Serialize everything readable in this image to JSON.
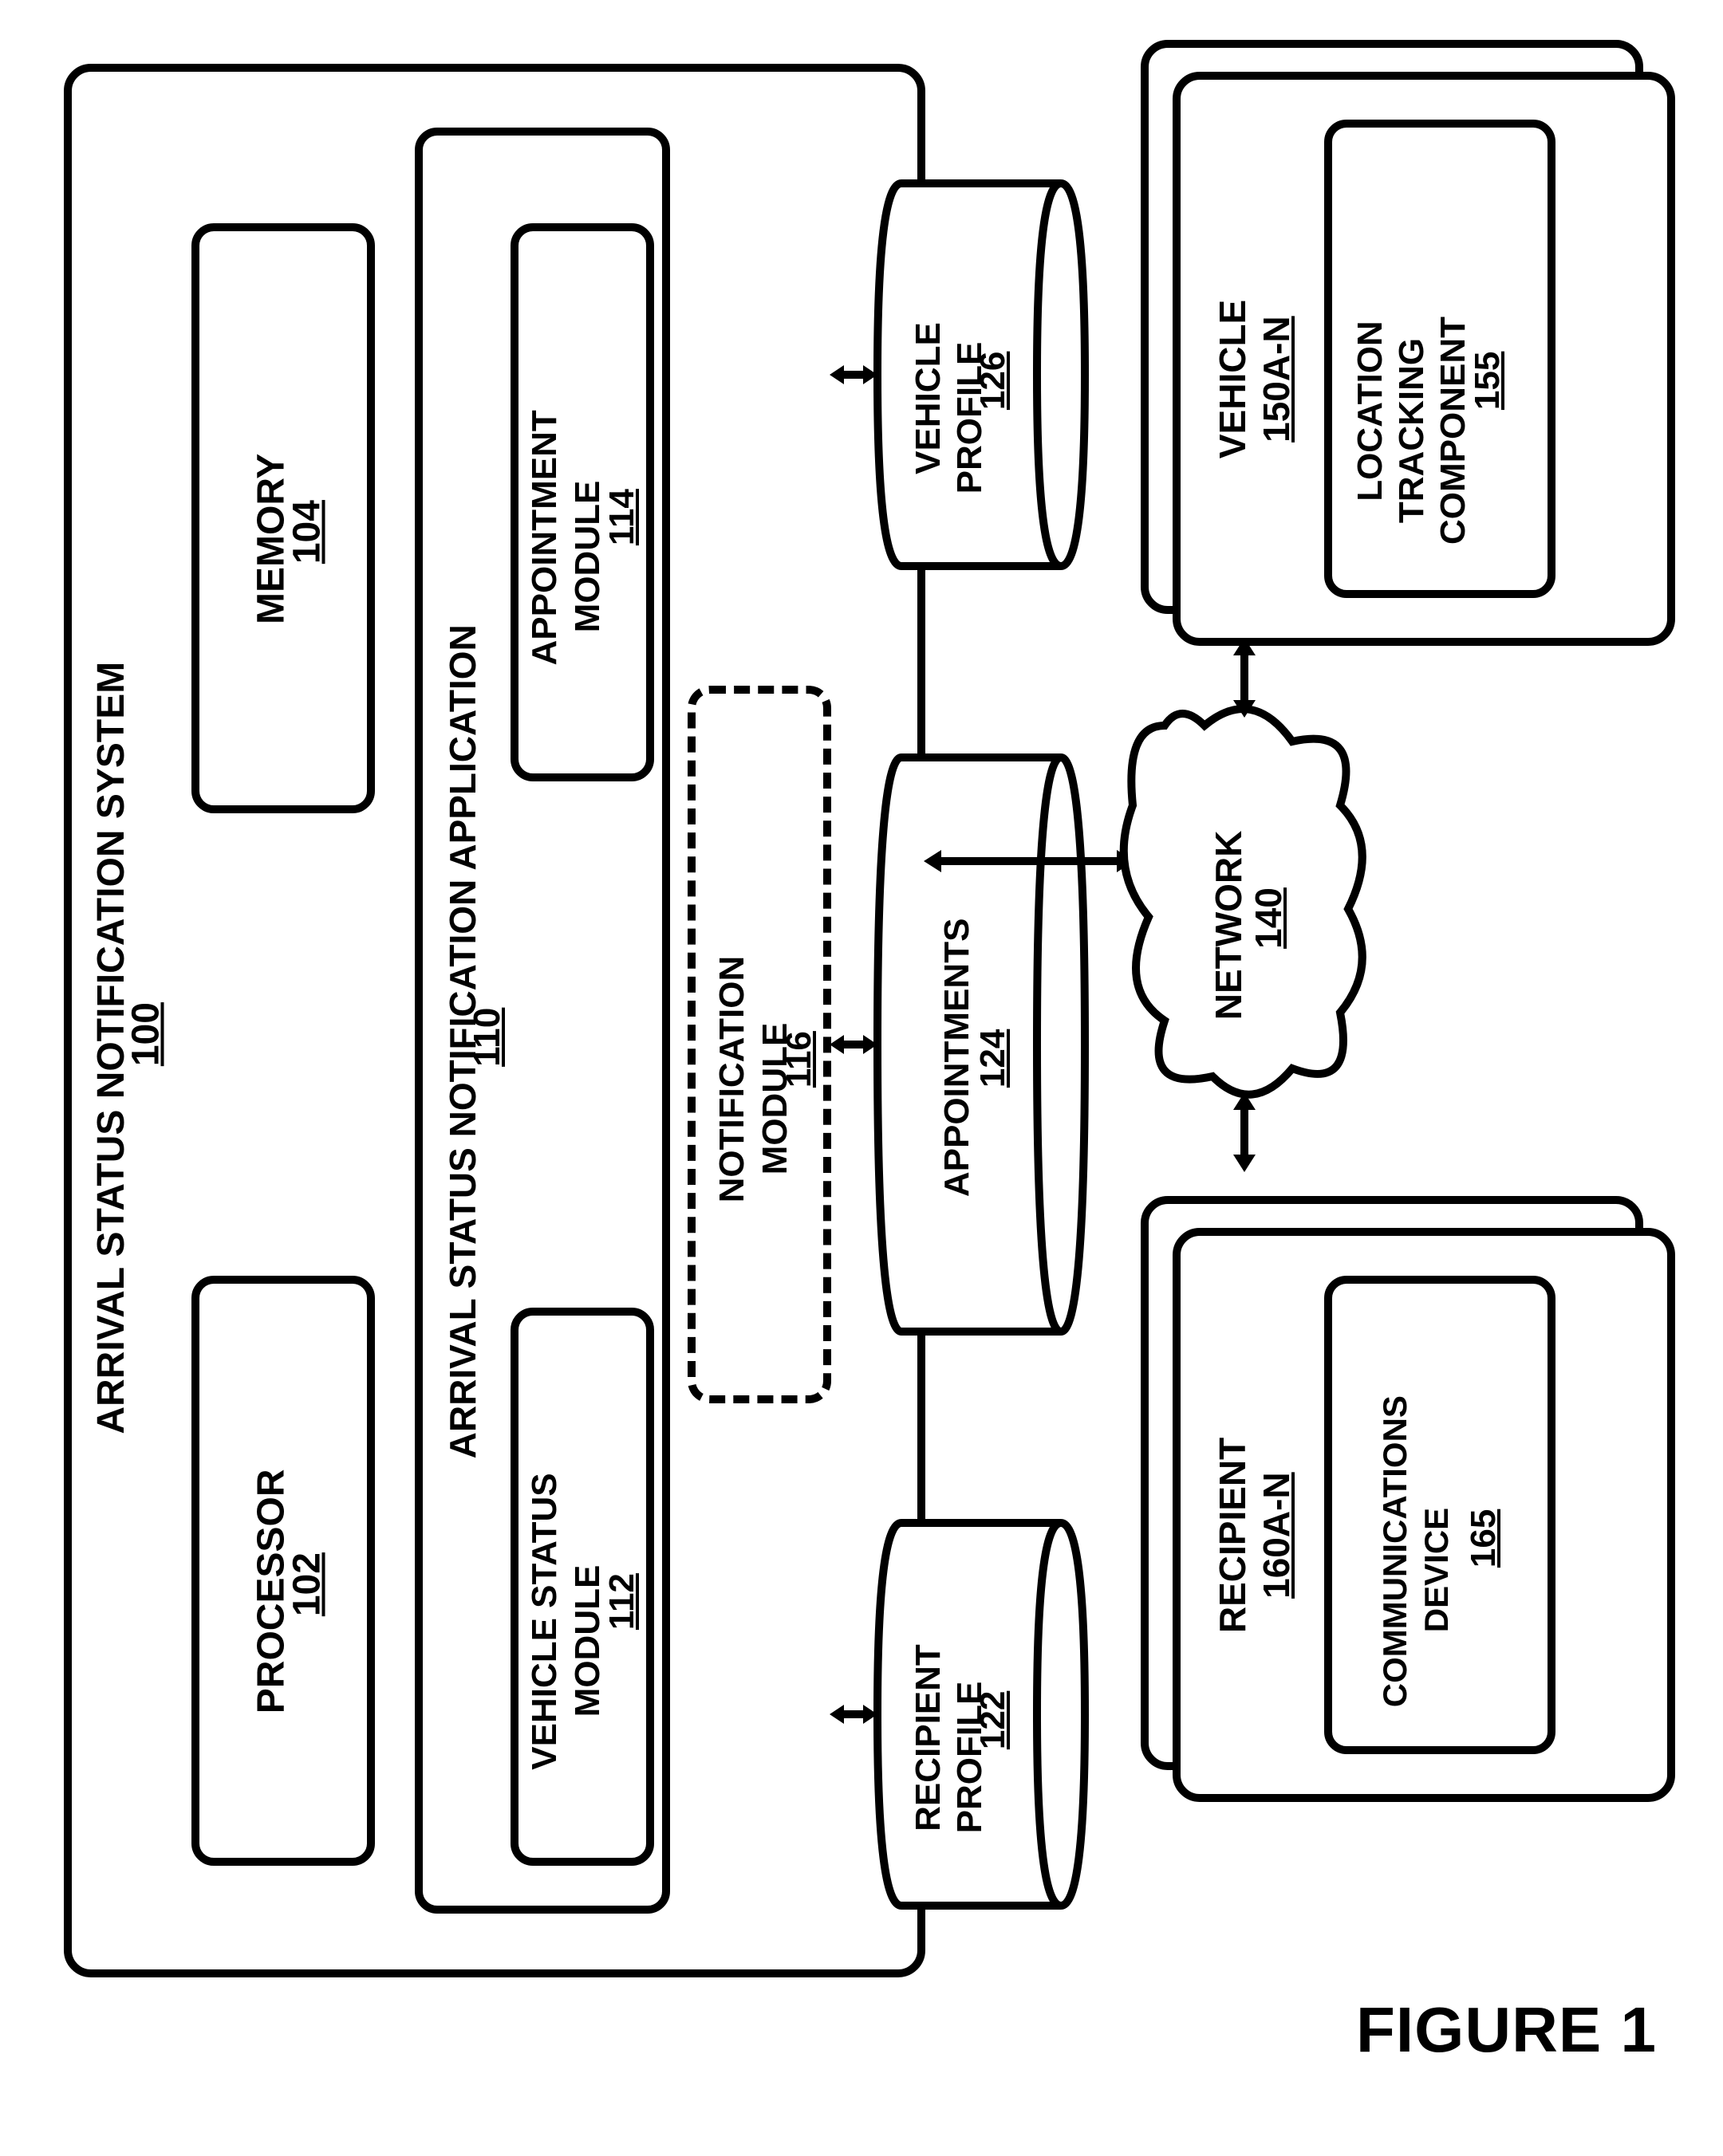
{
  "figure_label": "FIGURE 1",
  "system": {
    "title": "ARRIVAL STATUS NOTIFICATION SYSTEM",
    "ref": "100",
    "processor": {
      "label": "PROCESSOR",
      "ref": "102"
    },
    "memory": {
      "label": "MEMORY",
      "ref": "104"
    },
    "app": {
      "title": "ARRIVAL STATUS NOTIFICATION APPLICATION",
      "ref": "110",
      "vehicle_status": {
        "label": "VEHICLE STATUS\nMODULE",
        "ref": "112"
      },
      "appointment": {
        "label": "APPOINTMENT\nMODULE",
        "ref": "114"
      },
      "notification": {
        "label": "NOTIFICATION\nMODULE",
        "ref": "116"
      }
    },
    "db": {
      "recipient_profile": {
        "label": "RECIPIENT\nPROFILE",
        "ref": "122"
      },
      "appointments": {
        "label": "APPOINTMENTS",
        "ref": "124"
      },
      "vehicle_profile": {
        "label": "VEHICLE\nPROFILE",
        "ref": "126"
      }
    }
  },
  "network": {
    "label": "NETWORK",
    "ref": "140"
  },
  "vehicle": {
    "title": "VEHICLE",
    "ref": "150A-N",
    "tracking": {
      "label": "LOCATION\nTRACKING\nCOMPONENT",
      "ref": "155"
    }
  },
  "recipient": {
    "title": "RECIPIENT",
    "ref": "160A-N",
    "device": {
      "label": "COMMUNICATIONS\nDEVICE",
      "ref": "165"
    }
  }
}
